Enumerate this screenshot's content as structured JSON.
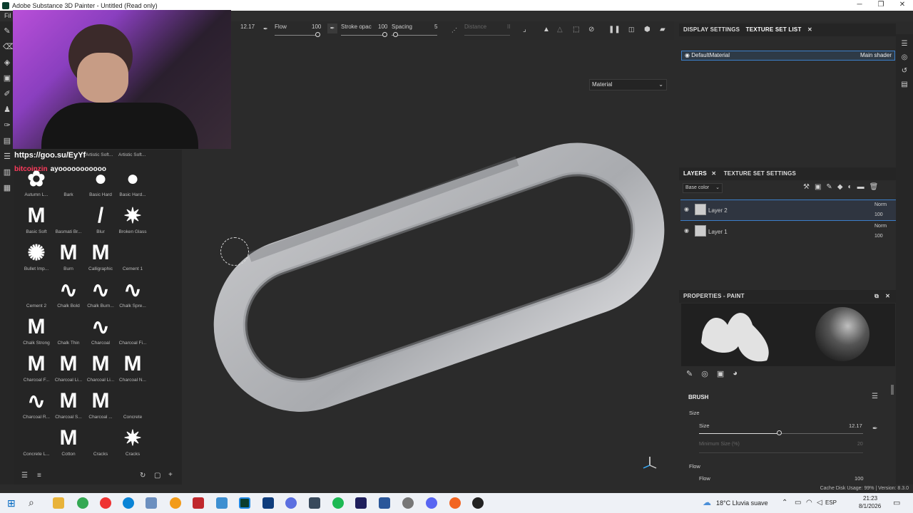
{
  "window": {
    "title": "Adobe Substance 3D Painter - Untitled (Read only)"
  },
  "menu": {
    "first": "Fil"
  },
  "toolbar": {
    "size_value": "12.17",
    "flow_label": "Flow",
    "flow_value": "100",
    "stroke_label": "Stroke opac",
    "stroke_value": "100",
    "spacing_label": "Spacing",
    "spacing_value": "5",
    "distance_label": "Distance",
    "distance_value": "II",
    "viewport_mode": "Material"
  },
  "overlay": {
    "link": "https://goo.su/EyYf",
    "chat_user": "bitcoinzin",
    "chat_message": "ayooooooooooo"
  },
  "shelf": {
    "header_labels": [
      "Artistic Soft...",
      "Artistic Soft..."
    ],
    "brushes": [
      {
        "label": "Autumn L...",
        "glyph": "✿"
      },
      {
        "label": "Bark",
        "glyph": ""
      },
      {
        "label": "Basic Hard",
        "glyph": "●"
      },
      {
        "label": "Basic Hard...",
        "glyph": "●"
      },
      {
        "label": "Basic Soft",
        "glyph": "M"
      },
      {
        "label": "Basmati Br...",
        "glyph": ""
      },
      {
        "label": "Blur",
        "glyph": "/"
      },
      {
        "label": "Broken Glass",
        "glyph": "✷"
      },
      {
        "label": "Bullet Imp...",
        "glyph": "✺"
      },
      {
        "label": "Burn",
        "glyph": "M"
      },
      {
        "label": "Calligraphic",
        "glyph": "M"
      },
      {
        "label": "Cement 1",
        "glyph": ""
      },
      {
        "label": "Cement 2",
        "glyph": ""
      },
      {
        "label": "Chalk Bold",
        "glyph": "∿"
      },
      {
        "label": "Chalk Burn...",
        "glyph": "∿"
      },
      {
        "label": "Chalk Spre...",
        "glyph": "∿"
      },
      {
        "label": "Chalk Strong",
        "glyph": "M"
      },
      {
        "label": "Chalk Thin",
        "glyph": ""
      },
      {
        "label": "Charcoal",
        "glyph": "∿"
      },
      {
        "label": "Charcoal Fi...",
        "glyph": ""
      },
      {
        "label": "Charcoal F...",
        "glyph": "M"
      },
      {
        "label": "Charcoal Li...",
        "glyph": "M"
      },
      {
        "label": "Charcoal Li...",
        "glyph": "M"
      },
      {
        "label": "Charcoal N...",
        "glyph": "M"
      },
      {
        "label": "Charcoal R...",
        "glyph": "∿"
      },
      {
        "label": "Charcoal S...",
        "glyph": "M"
      },
      {
        "label": "Charcoal ...",
        "glyph": "M"
      },
      {
        "label": "Concrete",
        "glyph": ""
      },
      {
        "label": "Concrete L...",
        "glyph": ""
      },
      {
        "label": "Cotton",
        "glyph": "M"
      },
      {
        "label": "Cracks",
        "glyph": ""
      },
      {
        "label": "Cracks",
        "glyph": "✷"
      }
    ]
  },
  "right": {
    "tab_display": "DISPLAY SETTINGS",
    "tab_texture": "TEXTURE SET LIST",
    "material": "DefaultMaterial",
    "shader": "Main shader",
    "layers_tab": "LAYERS",
    "texture_settings_tab": "TEXTURE SET SETTINGS",
    "channel": "Base color",
    "layers": [
      {
        "name": "Layer 2",
        "blend": "Norm",
        "opacity": "100"
      },
      {
        "name": "Layer 1",
        "blend": "Norm",
        "opacity": "100"
      }
    ],
    "properties_title": "PROPERTIES - PAINT",
    "brush_section": "BRUSH",
    "size_group": "Size",
    "size_label": "Size",
    "size_value": "12.17",
    "size_fraction": 0.49,
    "min_size_label": "Minimum Size (%)",
    "min_size_value": "20",
    "flow_group": "Flow",
    "flow_label": "Flow",
    "flow_value": "100"
  },
  "status": {
    "text": "Cache Disk Usage:  99% | Version: 8.3.0"
  },
  "taskbar": {
    "weather": "18°C  Lluvia suave",
    "lang": "ESP",
    "time": "21:23",
    "date": "8/1/2026"
  }
}
